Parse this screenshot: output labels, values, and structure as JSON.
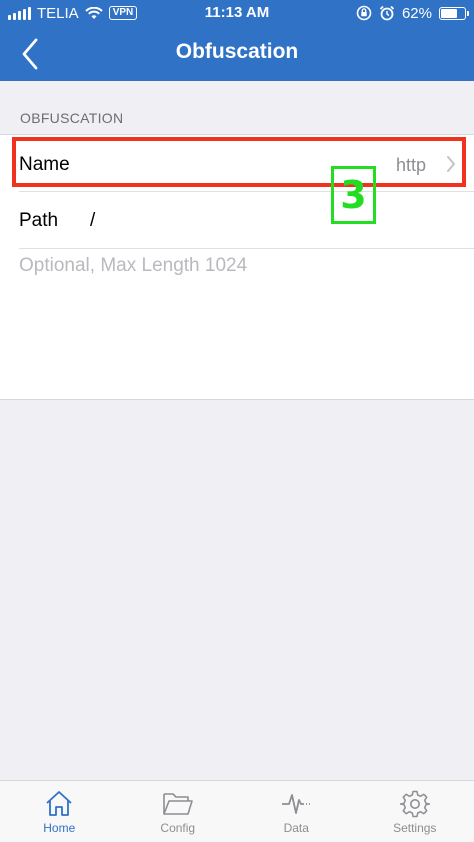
{
  "status_bar": {
    "carrier": "TELIA",
    "vpn": "VPN",
    "time": "11:13 AM",
    "battery_percent": "62%",
    "battery_level": 0.62
  },
  "nav": {
    "title": "Obfuscation"
  },
  "section": {
    "header": "OBFUSCATION"
  },
  "rows": {
    "name": {
      "label": "Name",
      "value": "http"
    },
    "path": {
      "label": "Path",
      "value": "/"
    }
  },
  "hint": {
    "placeholder": "Optional, Max Length 1024"
  },
  "annotation": {
    "marker": "3"
  },
  "tabs": [
    {
      "label": "Home",
      "icon": "home-icon",
      "active": true
    },
    {
      "label": "Config",
      "icon": "folder-icon",
      "active": false
    },
    {
      "label": "Data",
      "icon": "pulse-icon",
      "active": false
    },
    {
      "label": "Settings",
      "icon": "gear-icon",
      "active": false
    }
  ],
  "colors": {
    "accent": "#2f72c6",
    "highlight_red": "#f0321e",
    "marker_green": "#22dd22"
  }
}
